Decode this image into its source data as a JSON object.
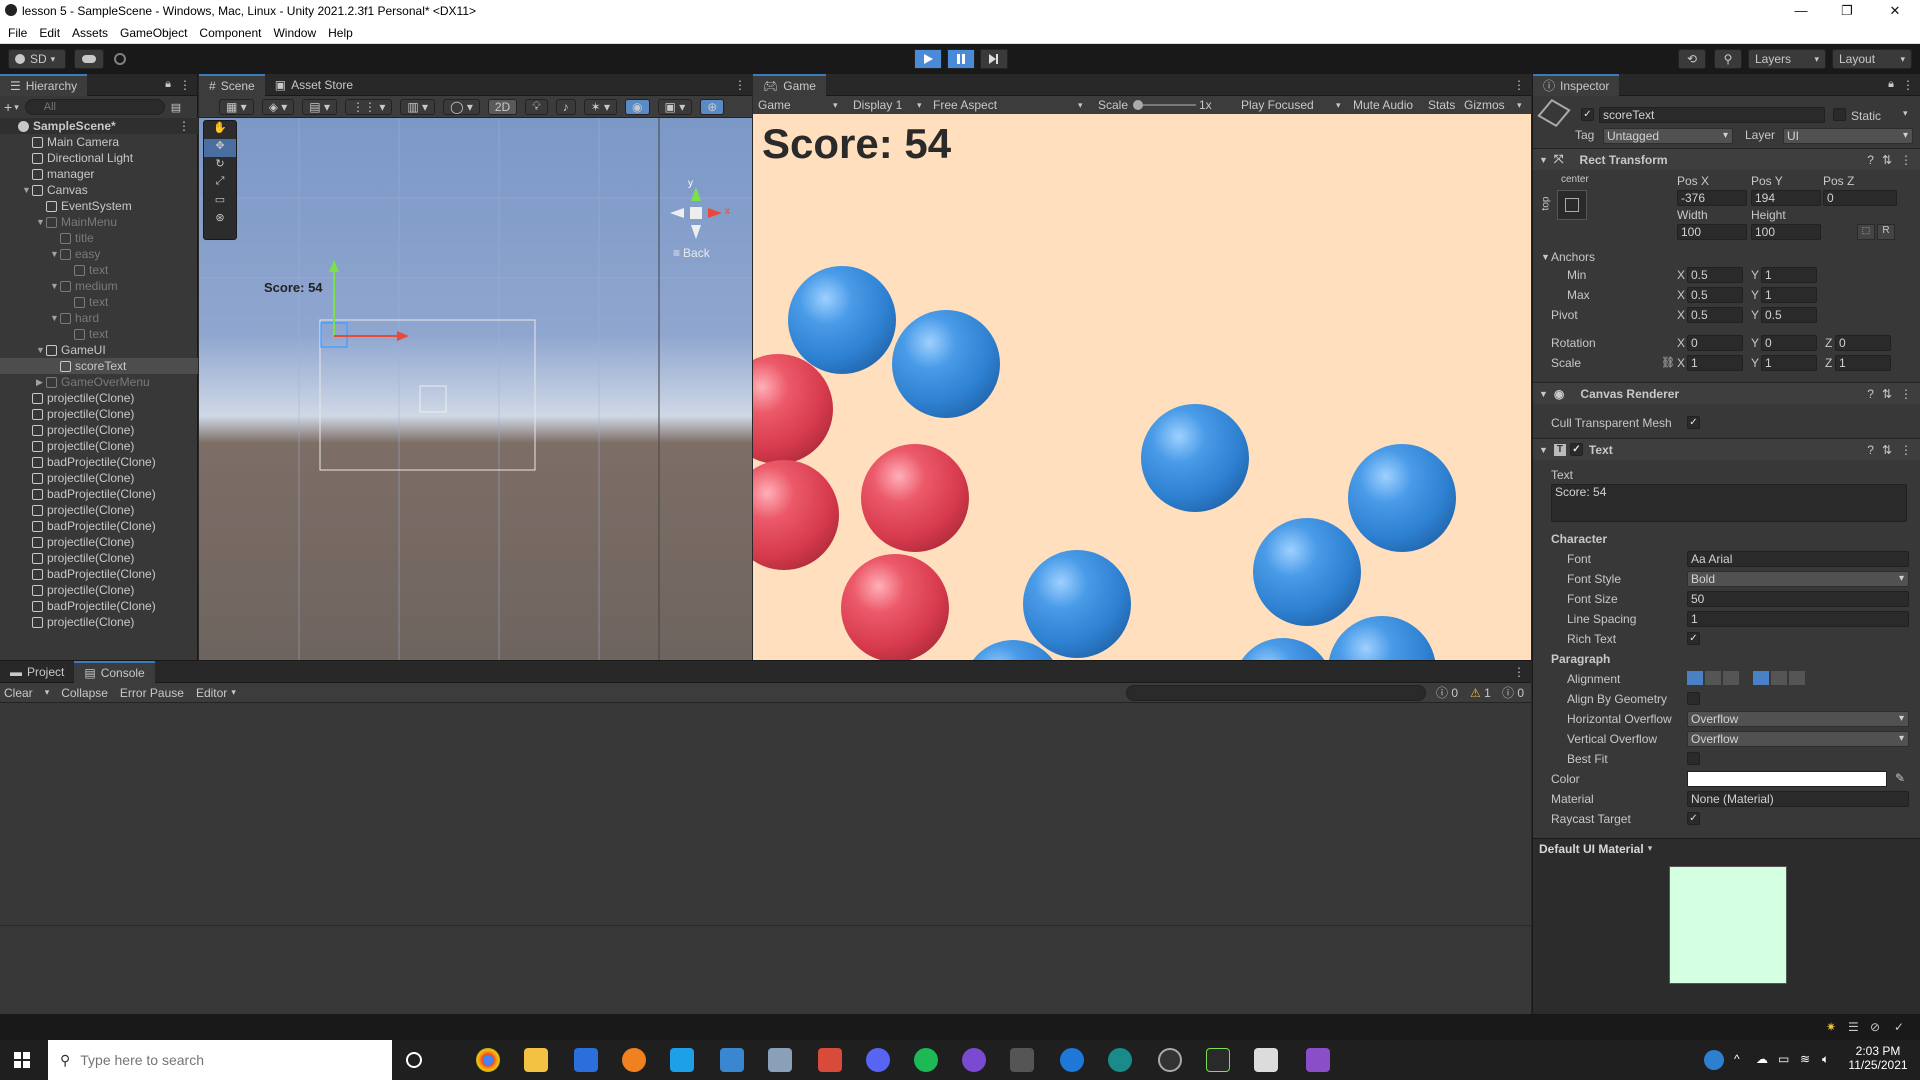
{
  "window": {
    "title": "lesson 5 - SampleScene - Windows, Mac, Linux - Unity 2021.2.3f1 Personal* <DX11>",
    "minimize": "—",
    "maximize": "❐",
    "close": "✕"
  },
  "menu": [
    "File",
    "Edit",
    "Assets",
    "GameObject",
    "Component",
    "Window",
    "Help"
  ],
  "toolbar": {
    "account": "SD",
    "layers": "Layers",
    "layout": "Layout"
  },
  "hierarchy": {
    "tab": "Hierarchy",
    "search_placeholder": "All",
    "rows": [
      {
        "label": "SampleScene*",
        "depth": 0,
        "kind": "scene"
      },
      {
        "label": "Main Camera",
        "depth": 1
      },
      {
        "label": "Directional Light",
        "depth": 1
      },
      {
        "label": "manager",
        "depth": 1
      },
      {
        "label": "Canvas",
        "depth": 1,
        "expanded": true
      },
      {
        "label": "EventSystem",
        "depth": 2
      },
      {
        "label": "MainMenu",
        "depth": 2,
        "expanded": true,
        "dim": true
      },
      {
        "label": "title",
        "depth": 3,
        "dim": true
      },
      {
        "label": "easy",
        "depth": 3,
        "expanded": true,
        "dim": true
      },
      {
        "label": "text",
        "depth": 4,
        "dim": true
      },
      {
        "label": "medium",
        "depth": 3,
        "expanded": true,
        "dim": true
      },
      {
        "label": "text",
        "depth": 4,
        "dim": true
      },
      {
        "label": "hard",
        "depth": 3,
        "expanded": true,
        "dim": true
      },
      {
        "label": "text",
        "depth": 4,
        "dim": true
      },
      {
        "label": "GameUI",
        "depth": 2,
        "expanded": true
      },
      {
        "label": "scoreText",
        "depth": 3,
        "selected": true
      },
      {
        "label": "GameOverMenu",
        "depth": 2,
        "collapsed": true,
        "dim": true
      },
      {
        "label": "projectile(Clone)",
        "depth": 1
      },
      {
        "label": "projectile(Clone)",
        "depth": 1
      },
      {
        "label": "projectile(Clone)",
        "depth": 1
      },
      {
        "label": "projectile(Clone)",
        "depth": 1
      },
      {
        "label": "badProjectile(Clone)",
        "depth": 1
      },
      {
        "label": "projectile(Clone)",
        "depth": 1
      },
      {
        "label": "badProjectile(Clone)",
        "depth": 1
      },
      {
        "label": "projectile(Clone)",
        "depth": 1
      },
      {
        "label": "badProjectile(Clone)",
        "depth": 1
      },
      {
        "label": "projectile(Clone)",
        "depth": 1
      },
      {
        "label": "projectile(Clone)",
        "depth": 1
      },
      {
        "label": "badProjectile(Clone)",
        "depth": 1
      },
      {
        "label": "projectile(Clone)",
        "depth": 1
      },
      {
        "label": "badProjectile(Clone)",
        "depth": 1
      },
      {
        "label": "projectile(Clone)",
        "depth": 1
      }
    ]
  },
  "scene": {
    "tab_scene": "Scene",
    "tab_asset_store": "Asset Store",
    "btn_2d": "2D",
    "back": "Back",
    "score_label": "Score: 54",
    "gizmo_y": "y",
    "gizmo_x": "x"
  },
  "game": {
    "tab": "Game",
    "display_mode": "Game",
    "display": "Display 1",
    "aspect": "Free Aspect",
    "scale_label": "Scale",
    "scale_value": "1x",
    "play_focused": "Play Focused",
    "mute": "Mute Audio",
    "stats": "Stats",
    "gizmos": "Gizmos",
    "score": "Score: 54"
  },
  "inspector": {
    "tab": "Inspector",
    "object_name": "scoreText",
    "static_label": "Static",
    "tag_label": "Tag",
    "tag_value": "Untagged",
    "layer_label": "Layer",
    "layer_value": "UI",
    "rect": {
      "title": "Rect Transform",
      "anchor_h": "center",
      "anchor_v": "top",
      "posx_label": "Pos X",
      "posx": "-376",
      "posy_label": "Pos Y",
      "posy": "194",
      "posz_label": "Pos Z",
      "posz": "0",
      "width_label": "Width",
      "width": "100",
      "height_label": "Height",
      "height": "100",
      "r_btn": "R",
      "anchors_label": "Anchors",
      "min_label": "Min",
      "min_x": "0.5",
      "min_y": "1",
      "max_label": "Max",
      "max_x": "0.5",
      "max_y": "1",
      "pivot_label": "Pivot",
      "pivot_x": "0.5",
      "pivot_y": "0.5",
      "rotation_label": "Rotation",
      "rot_x": "0",
      "rot_y": "0",
      "rot_z": "0",
      "scale_label": "Scale",
      "scale_x": "1",
      "scale_y": "1",
      "scale_z": "1",
      "x": "X",
      "y": "Y",
      "z": "Z"
    },
    "canvas_renderer": {
      "title": "Canvas Renderer",
      "cull_label": "Cull Transparent Mesh"
    },
    "text": {
      "title": "Text",
      "text_label": "Text",
      "text_value": "Score: 54",
      "character": "Character",
      "font_label": "Font",
      "font_value": "Aa Arial",
      "style_label": "Font Style",
      "style_value": "Bold",
      "size_label": "Font Size",
      "size_value": "50",
      "spacing_label": "Line Spacing",
      "spacing_value": "1",
      "rich_label": "Rich Text",
      "paragraph": "Paragraph",
      "align_label": "Alignment",
      "geom_label": "Align By Geometry",
      "hover_label": "Horizontal Overflow",
      "hover_value": "Overflow",
      "vover_label": "Vertical Overflow",
      "vover_value": "Overflow",
      "best_label": "Best Fit",
      "color_label": "Color",
      "material_label": "Material",
      "material_value": "None (Material)",
      "raycast_label": "Raycast Target"
    },
    "material_preview": "Default UI Material"
  },
  "console": {
    "tab_project": "Project",
    "tab_console": "Console",
    "clear": "Clear",
    "collapse": "Collapse",
    "error_pause": "Error Pause",
    "editor": "Editor",
    "count_logs": "0",
    "count_warn": "1",
    "count_err": "0"
  },
  "taskbar": {
    "search_placeholder": "Type here to search",
    "time": "2:03 PM",
    "date": "11/25/2021"
  },
  "colors": {
    "game_bg": "#ffdfbd",
    "blue_ball": "#2d7fd0",
    "red_ball": "#d63a4c",
    "selection": "#4d4d4d",
    "accent": "#3a79bb"
  }
}
